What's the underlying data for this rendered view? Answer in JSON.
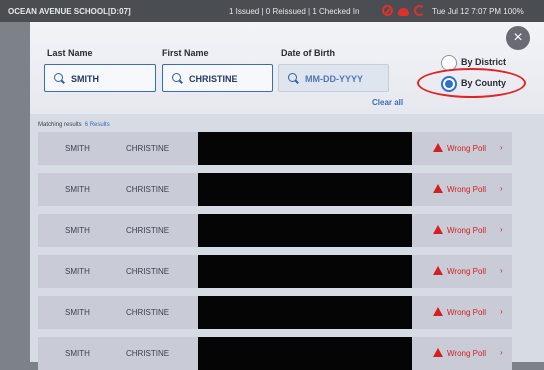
{
  "status_bar": {
    "location": "OCEAN AVENUE SCHOOL[D:07]",
    "counts": "1 Issued | 0 Reissued | 1 Checked In",
    "datetime_battery": "Tue Jul 12  7:07 PM  100%",
    "icons": [
      "no-entry-icon",
      "cloud-alert-icon",
      "sync-icon"
    ],
    "status_color": "#e0302b"
  },
  "search": {
    "last_name_label": "Last Name",
    "last_name_value": "SMITH",
    "first_name_label": "First Name",
    "first_name_value": "CHRISTINE",
    "dob_label": "Date of Birth",
    "dob_placeholder": "MM-DD-YYYY",
    "clear_all": "Clear all"
  },
  "scope": {
    "options": [
      {
        "label": "By District",
        "selected": false
      },
      {
        "label": "By County",
        "selected": true
      }
    ]
  },
  "close_icon": "×",
  "results": {
    "label": "Matching results",
    "count": "6 Results",
    "rows": [
      {
        "last": "SMITH",
        "first": "CHRISTINE",
        "status": "Wrong Poll"
      },
      {
        "last": "SMITH",
        "first": "CHRISTINE",
        "status": "Wrong Poll"
      },
      {
        "last": "SMITH",
        "first": "CHRISTINE",
        "status": "Wrong Poll"
      },
      {
        "last": "SMITH",
        "first": "CHRISTINE",
        "status": "Wrong Poll"
      },
      {
        "last": "SMITH",
        "first": "CHRISTINE",
        "status": "Wrong Poll"
      },
      {
        "last": "SMITH",
        "first": "CHRISTINE",
        "status": "Wrong Poll"
      }
    ]
  },
  "colors": {
    "accent": "#3a6cb3",
    "warning": "#d32020",
    "highlight": "#e02424"
  }
}
